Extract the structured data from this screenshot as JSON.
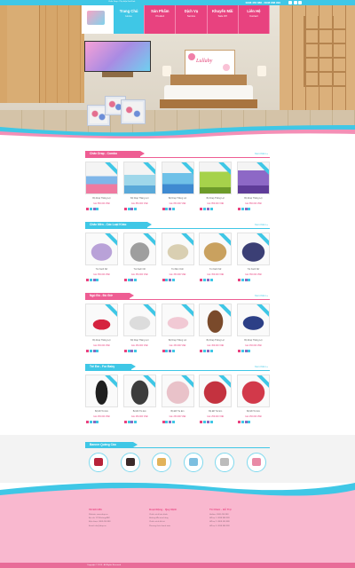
{
  "topbar": {
    "left_text": "Chăn Drap - Phụ kiện Gia Đình",
    "hotline": "0908 456 888 - 0938 888 999"
  },
  "nav": [
    {
      "title": "Trang Chủ",
      "sub": "Home"
    },
    {
      "title": "Sản Phẩm",
      "sub": "Product"
    },
    {
      "title": "Dịch Vụ",
      "sub": "Service"
    },
    {
      "title": "Khuyến Mãi",
      "sub": "Sale Off"
    },
    {
      "title": "Liên Hệ",
      "sub": "Contact"
    }
  ],
  "hero": {
    "painting_text": "Lullaby"
  },
  "sections": [
    {
      "title": "Chăn Drap - Combo",
      "more": "Xem thêm »",
      "products": [
        {
          "name": "Bộ Drap Thắng Lợi",
          "price": "Giá: 850.000 VNĐ"
        },
        {
          "name": "Bộ Drap Thắng Lợi",
          "price": "Giá: 850.000 VNĐ"
        },
        {
          "name": "Bộ Drap Thắng Lợi",
          "price": "Giá: 850.000 VNĐ"
        },
        {
          "name": "Bộ Drap Thắng Lợi",
          "price": "Giá: 850.000 VNĐ"
        },
        {
          "name": "Bộ Drap Thắng Lợi",
          "price": "Giá: 850.000 VNĐ"
        }
      ]
    },
    {
      "title": "Chăn Mền - Các Loại Khác",
      "more": "Xem thêm »",
      "products": [
        {
          "name": "Túi Xách Nữ",
          "price": "Giá: 350.000 VNĐ"
        },
        {
          "name": "Túi Xách Nữ",
          "price": "Giá: 350.000 VNĐ"
        },
        {
          "name": "Túi Mini Xinh",
          "price": "Giá: 350.000 VNĐ"
        },
        {
          "name": "Túi Xách Nữ",
          "price": "Giá: 350.000 VNĐ"
        },
        {
          "name": "Túi Xách Nữ",
          "price": "Giá: 350.000 VNĐ"
        }
      ]
    },
    {
      "title": "Ngủ Đủ - Đủ Giờ",
      "more": "Xem thêm »",
      "products": [
        {
          "name": "Bộ Drap Thắng Lợi",
          "price": "Giá: 450.000 VNĐ"
        },
        {
          "name": "Bộ Drap Thắng Lợi",
          "price": "Giá: 450.000 VNĐ"
        },
        {
          "name": "Bộ Drap Thắng Lợi",
          "price": "Giá: 450.000 VNĐ"
        },
        {
          "name": "Bộ Drap Thắng Lợi",
          "price": "Giá: 450.000 VNĐ"
        },
        {
          "name": "Bộ Drap Thắng Lợi",
          "price": "Giá: 450.000 VNĐ"
        }
      ]
    },
    {
      "title": "Trẻ Em - For Baby",
      "more": "Xem thêm »",
      "products": [
        {
          "name": "Bộ Đồ Trẻ Em",
          "price": "Giá: 250.000 VNĐ"
        },
        {
          "name": "Bộ Đồ Trẻ Em",
          "price": "Giá: 250.000 VNĐ"
        },
        {
          "name": "Bộ Đồ Trẻ Em",
          "price": "Giá: 250.000 VNĐ"
        },
        {
          "name": "Bộ Đồ Trẻ Em",
          "price": "Giá: 250.000 VNĐ"
        },
        {
          "name": "Bộ Đồ Trẻ Em",
          "price": "Giá: 250.000 VNĐ"
        }
      ]
    }
  ],
  "banner": {
    "title": "Banner Quảng Cáo"
  },
  "footer": {
    "cols": [
      {
        "title": "Về Bởi Mô",
        "rows": [
          "Website: www.drap.vn",
          "Địa chỉ: 123 Đường ABC",
          "Điện thoại: 0908 456 888",
          "Email: info@drap.vn"
        ]
      },
      {
        "title": "Hoạt Động - Quy Định",
        "rows": [
          "Chính sách bảo hành",
          "Hướng dẫn mua hàng",
          "Chính sách đổi trả",
          "Phương thức thanh toán"
        ]
      },
      {
        "title": "Tổ Chức - Hỗ Trợ",
        "rows": [
          "Hotline: 0908 456 888",
          "Hỗ trợ 1: 0938 888 999",
          "Hỗ trợ 2: 0908 456 888",
          "Hỗ trợ 3: 0938 888 999"
        ]
      }
    ],
    "copyright": "Copyright © 2015 - All Rights Reserved"
  },
  "colors": {
    "accent_blue": "#3fc7e6",
    "accent_pink": "#e8427f"
  }
}
